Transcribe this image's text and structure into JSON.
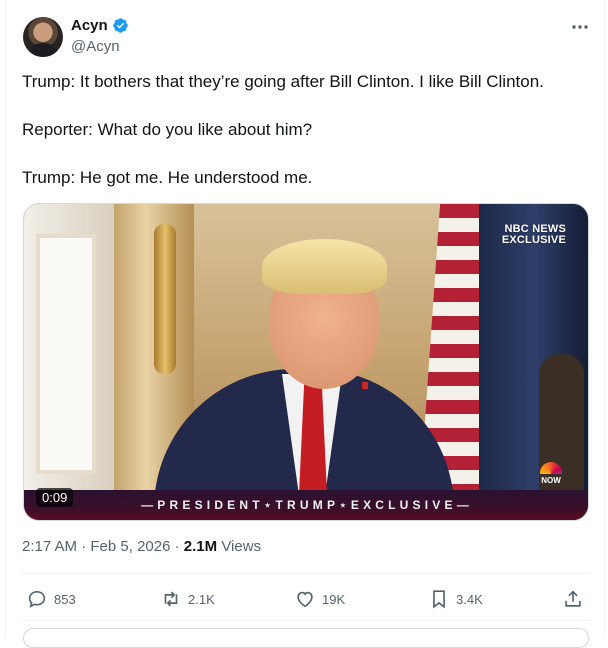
{
  "author": {
    "name": "Acyn",
    "handle": "@Acyn",
    "verified": true,
    "verified_color": "#1d9bf0"
  },
  "tweet": {
    "lines": [
      "Trump: It bothers that they’re going after Bill Clinton. I like Bill Clinton.",
      "Reporter: What do you like about him?",
      "Trump: He got me. He understood me."
    ]
  },
  "media": {
    "type": "video",
    "duration": "0:09",
    "network_badge_line1": "NBC NEWS",
    "network_badge_line2": "EXCLUSIVE",
    "network_corner": "NOW",
    "lower_third": "—PRESIDENT⋆TRUMP⋆EXCLUSIVE—"
  },
  "meta": {
    "time": "2:17 AM",
    "date": "Feb 5, 2026",
    "views_count": "2.1M",
    "views_label": "Views",
    "separator": "·"
  },
  "actions": {
    "replies": "853",
    "reposts": "2.1K",
    "likes": "19K",
    "bookmarks": "3.4K"
  },
  "icons": {
    "more": "more-horizontal-icon",
    "reply": "reply-bubble-icon",
    "repost": "repost-icon",
    "like": "heart-icon",
    "bookmark": "bookmark-icon",
    "share": "share-upload-icon"
  },
  "colors": {
    "text_primary": "#0f1419",
    "text_secondary": "#536471",
    "border": "#eff3f4",
    "verified": "#1d9bf0",
    "lower_third_bg": "#3a0f2a"
  }
}
